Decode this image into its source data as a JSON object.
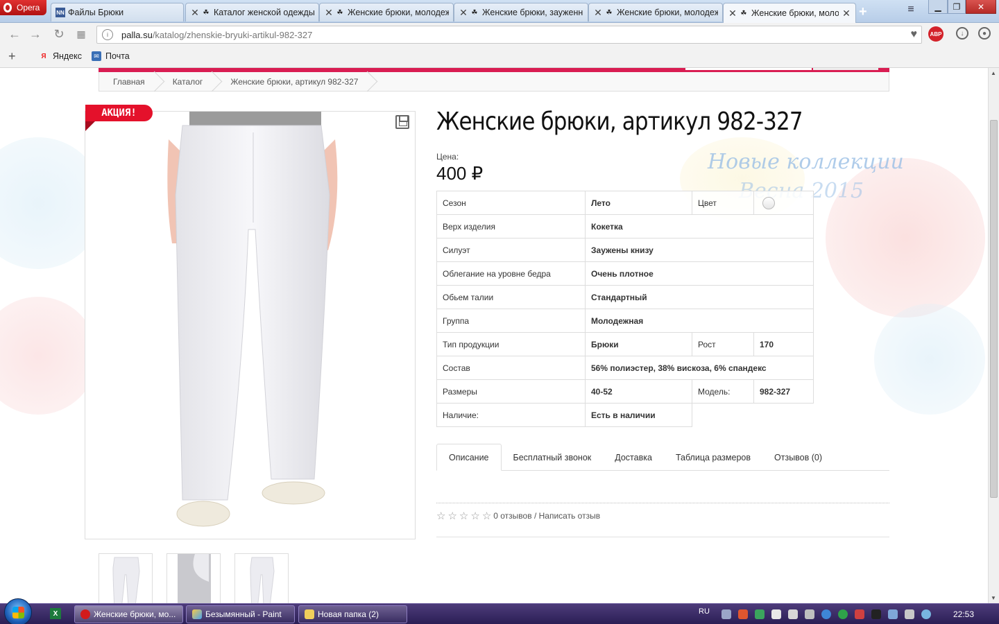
{
  "browser": {
    "menu_label": "Opera",
    "tabs": [
      {
        "title": "Файлы Брюки",
        "favicon": "nn-icon",
        "active": false
      },
      {
        "title": "Каталог женской одежды",
        "favicon": "palla-icon",
        "active": false
      },
      {
        "title": "Женские брюки, молодежн",
        "favicon": "palla-icon",
        "active": false
      },
      {
        "title": "Женские брюки, зауженн",
        "favicon": "palla-icon",
        "active": false
      },
      {
        "title": "Женские брюки, молодежн",
        "favicon": "palla-icon",
        "active": false
      },
      {
        "title": "Женские брюки, молоде",
        "favicon": "palla-icon",
        "active": true
      }
    ],
    "url_host": "palla.su",
    "url_path": "/katalog/zhenskie-bryuki-artikul-982-327",
    "abp_label": "ABP",
    "bookmarks": [
      {
        "label": "Яндекс",
        "icon": "yandex-icon"
      },
      {
        "label": "Почта",
        "icon": "mail-icon"
      }
    ]
  },
  "breadcrumb": [
    "Главная",
    "Каталог",
    "Женские брюки, артикул 982-327"
  ],
  "product": {
    "sale_badge": "АКЦИЯ!",
    "title": "Женские брюки, артикул 982-327",
    "price_label": "Цена:",
    "price": "400 ₽",
    "promo_line1": "Новые коллекции",
    "promo_line2": "Весна 2015"
  },
  "specs": [
    {
      "label": "Сезон",
      "value": "Лето",
      "label2": "Цвет",
      "value2": ""
    },
    {
      "label": "Верх изделия",
      "value": "Кокетка"
    },
    {
      "label": "Силуэт",
      "value": "Заужены книзу"
    },
    {
      "label": "Облегание на уровне бедра",
      "value": "Очень плотное"
    },
    {
      "label": "Обьем талии",
      "value": "Стандартный"
    },
    {
      "label": "Группа",
      "value": "Молодежная"
    },
    {
      "label": "Тип продукции",
      "value": "Брюки",
      "label2": "Рост",
      "value2": "170"
    },
    {
      "label": "Состав",
      "value": "56% полиэстер, 38% вискоза, 6% спандекс"
    },
    {
      "label": "Размеры",
      "value": "40-52",
      "label2": "Модель:",
      "value2": "982-327"
    },
    {
      "label": "Наличие:",
      "value": "Есть в наличии"
    }
  ],
  "tabs": [
    "Описание",
    "Бесплатный звонок",
    "Доставка",
    "Таблица размеров",
    "Отзывов (0)"
  ],
  "rating": {
    "stars": 0,
    "max_stars": 5,
    "reviews_link": "0 отзывов",
    "separator": " / ",
    "write_link": "Написать отзыв"
  },
  "taskbar": {
    "tasks": [
      {
        "label": "Женские брюки, мо...",
        "active": true
      },
      {
        "label": "Безымянный - Paint",
        "active": false
      },
      {
        "label": "Новая папка (2)",
        "active": false
      }
    ],
    "language": "RU",
    "clock": "22:53"
  },
  "colors": {
    "accent": "#d91d52",
    "sale": "#e4112b",
    "taskbar": "#3a2c68"
  }
}
